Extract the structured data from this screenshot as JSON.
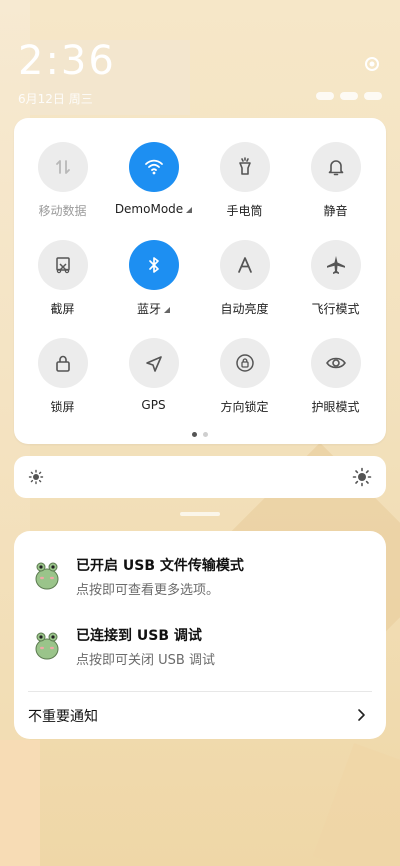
{
  "status_bar": {
    "time": "2:36",
    "date": "6月12日 周三"
  },
  "control_center": {
    "tiles": [
      {
        "label": "移动数据",
        "icon": "mobile-data-icon",
        "state": "disabled"
      },
      {
        "label": "DemoMode",
        "icon": "wifi-icon",
        "state": "on"
      },
      {
        "label": "手电筒",
        "icon": "flashlight-icon",
        "state": "off"
      },
      {
        "label": "静音",
        "icon": "bell-icon",
        "state": "off"
      },
      {
        "label": "截屏",
        "icon": "screenshot-icon",
        "state": "off"
      },
      {
        "label": "蓝牙",
        "icon": "bluetooth-icon",
        "state": "on"
      },
      {
        "label": "自动亮度",
        "icon": "auto-brightness-icon",
        "state": "off"
      },
      {
        "label": "飞行模式",
        "icon": "airplane-icon",
        "state": "off"
      },
      {
        "label": "锁屏",
        "icon": "lock-icon",
        "state": "off"
      },
      {
        "label": "GPS",
        "icon": "gps-icon",
        "state": "off"
      },
      {
        "label": "方向锁定",
        "icon": "rotation-lock-icon",
        "state": "off"
      },
      {
        "label": "护眼模式",
        "icon": "eye-icon",
        "state": "off"
      }
    ],
    "page_index": 1,
    "page_count": 2
  },
  "brightness": {
    "low_icon": "brightness-low-icon",
    "high_icon": "brightness-high-icon"
  },
  "notifications": {
    "items": [
      {
        "title": "已开启 USB 文件传输模式",
        "subtitle": "点按即可查看更多选项。",
        "icon": "android-frog-icon"
      },
      {
        "title": "已连接到 USB 调试",
        "subtitle": "点按即可关闭 USB 调试",
        "icon": "android-frog-icon"
      }
    ],
    "footer_label": "不重要通知"
  },
  "colors": {
    "accent": "#1d8ff2",
    "tile_off": "#ececec",
    "card": "#ffffff"
  }
}
